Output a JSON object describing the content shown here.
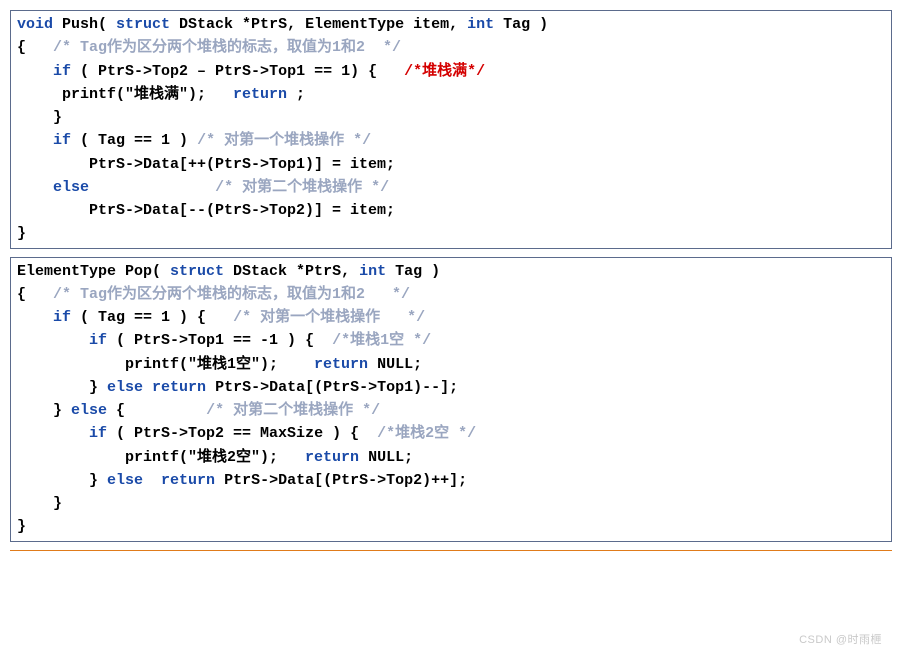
{
  "push": {
    "l1_void": "void",
    "l1_fn": " Push( ",
    "l1_struct": "struct",
    "l1_rest1": " DStack *PtrS, ElementType item, ",
    "l1_int": "int",
    "l1_rest2": " Tag )",
    "l2_open": "{   ",
    "l2_cm": "/* Tag作为区分两个堆栈的标志，取值为1和2  */",
    "l3a": "    ",
    "l3_if": "if",
    "l3b": " ( PtrS->Top2 – PtrS->Top1 == 1) {   ",
    "l3_cm": "/*堆栈满*/",
    "l4a": "     printf(\"堆栈满\");   ",
    "l4_ret": "return",
    "l4b": " ;",
    "l5": "    }",
    "l6a": "    ",
    "l6_if": "if",
    "l6b": " ( Tag == 1 ) ",
    "l6_cm": "/* 对第一个堆栈操作 */",
    "l7": "        PtrS->Data[++(PtrS->Top1)] = item;",
    "l8a": "    ",
    "l8_else": "else",
    "l8b": "              ",
    "l8_cm": "/* 对第二个堆栈操作 */",
    "l9": "        PtrS->Data[--(PtrS->Top2)] = item;",
    "l10": "}"
  },
  "pop": {
    "l1a": "ElementType Pop( ",
    "l1_struct": "struct",
    "l1b": " DStack *PtrS, ",
    "l1_int": "int",
    "l1c": " Tag )",
    "l2a": "{   ",
    "l2_cm": "/* Tag作为区分两个堆栈的标志，取值为1和2   */",
    "l3a": "    ",
    "l3_if": "if",
    "l3b": " ( Tag == 1 ) {   ",
    "l3_cm": "/* 对第一个堆栈操作   */",
    "l4a": "        ",
    "l4_if": "if",
    "l4b": " ( PtrS->Top1 == -1 ) {  ",
    "l4_cm": "/*堆栈1空 */",
    "l5a": "            printf(\"堆栈1空\");    ",
    "l5_ret": "return",
    "l5b": " NULL;",
    "l6a": "        } ",
    "l6_else": "else",
    "l6b": " ",
    "l6_ret": "return",
    "l6c": " PtrS->Data[(PtrS->Top1)--];",
    "l7a": "    } ",
    "l7_else": "else",
    "l7b": " {         ",
    "l7_cm": "/* 对第二个堆栈操作 */",
    "l8a": "        ",
    "l8_if": "if",
    "l8b": " ( PtrS->Top2 == MaxSize ) {  ",
    "l8_cm": "/*堆栈2空 */",
    "l9a": "            printf(\"堆栈2空\");   ",
    "l9_ret": "return",
    "l9b": " NULL;",
    "l10a": "        } ",
    "l10_else": "else",
    "l10b": "  ",
    "l10_ret": "return",
    "l10c": " PtrS->Data[(PtrS->Top2)++];",
    "l11": "    }",
    "l12": "}"
  },
  "watermark": "CSDN @时雨㭱"
}
